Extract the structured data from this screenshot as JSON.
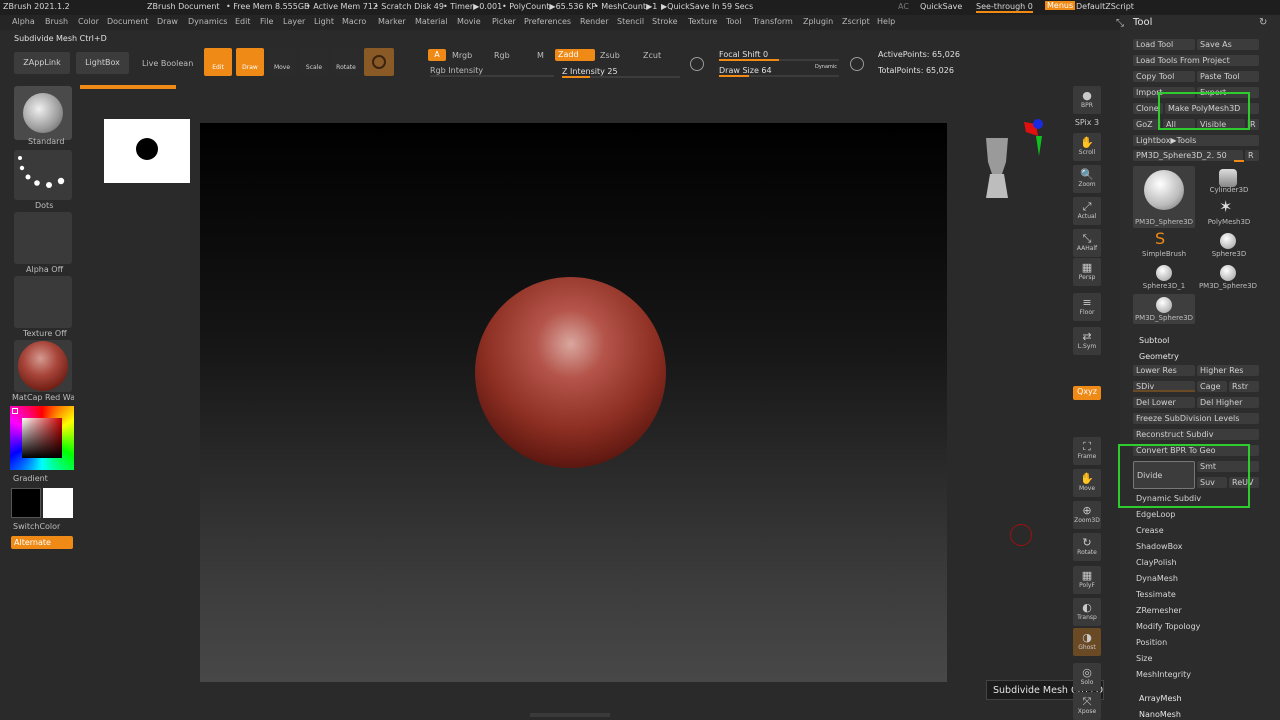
{
  "titlebar": {
    "app": "ZBrush 2021.1.2",
    "document": "ZBrush Document",
    "free_mem": "• Free Mem 8.555GB",
    "active_mem": "• Active Mem 712",
    "scratch": "• Scratch Disk 49",
    "timer": "• Timer▶0.001",
    "polycount": "• PolyCount▶65.536 KP",
    "meshcount": "• MeshCount▶1",
    "quicksave_timer": "▶QuickSave In 59 Secs",
    "ac": "AC",
    "quicksave": "QuickSave",
    "seethrough": "See-through  0",
    "menus": "Menus",
    "zscript": "DefaultZScript"
  },
  "menubar": [
    "Alpha",
    "Brush",
    "Color",
    "Document",
    "Draw",
    "Dynamics",
    "Edit",
    "File",
    "Layer",
    "Light",
    "Macro",
    "Marker",
    "Material",
    "Movie",
    "Picker",
    "Preferences",
    "Render",
    "Stencil",
    "Stroke",
    "Texture",
    "Tool",
    "Transform",
    "Zplugin",
    "Zscript",
    "Help"
  ],
  "subtitle": "Subdivide Mesh Ctrl+D",
  "topbar": {
    "zapplink": "ZAppLink",
    "lightbox": "LightBox",
    "liveboolean": "Live Boolean",
    "edit": "Edit",
    "draw": "Draw",
    "move": "Move",
    "scale": "Scale",
    "rotate": "Rotate",
    "a": "A",
    "mrgb": "Mrgb",
    "rgb": "Rgb",
    "m": "M",
    "zadd": "Zadd",
    "zsub": "Zsub",
    "zcut": "Zcut",
    "rgb_intensity": "Rgb Intensity",
    "z_intensity": "Z Intensity 25",
    "focal_shift": "Focal Shift 0",
    "draw_size": "Draw Size 64",
    "dynamic": "Dynamic",
    "active_points": "ActivePoints: 65,026",
    "total_points": "TotalPoints: 65,026"
  },
  "leftshelf": {
    "brush": "Standard",
    "stroke": "Dots",
    "alpha": "Alpha Off",
    "texture": "Texture Off",
    "material": "MatCap Red Wax",
    "gradient": "Gradient",
    "switchcolor": "SwitchColor",
    "alternate": "Alternate"
  },
  "rightshelf": [
    {
      "id": "bpr",
      "label": "BPR"
    },
    {
      "id": "spix",
      "label": "SPix 3"
    },
    {
      "id": "scroll",
      "label": "Scroll"
    },
    {
      "id": "zoom",
      "label": "Zoom"
    },
    {
      "id": "actual",
      "label": "Actual"
    },
    {
      "id": "aahalf",
      "label": "AAHalf"
    },
    {
      "id": "persp",
      "label": "Persp"
    },
    {
      "id": "floor",
      "label": "Floor"
    },
    {
      "id": "lsym",
      "label": "L.Sym"
    },
    {
      "id": "xyz",
      "label": "Qxyz"
    },
    {
      "id": "frame",
      "label": "Frame"
    },
    {
      "id": "move",
      "label": "Move"
    },
    {
      "id": "zoom3d",
      "label": "Zoom3D"
    },
    {
      "id": "rotate",
      "label": "Rotate"
    },
    {
      "id": "polyf",
      "label": "PolyF"
    },
    {
      "id": "transp",
      "label": "Transp"
    },
    {
      "id": "ghost",
      "label": "Ghost"
    },
    {
      "id": "solo",
      "label": "Solo"
    },
    {
      "id": "xpose",
      "label": "Xpose"
    }
  ],
  "toolpanel": {
    "title": "Tool",
    "load_tool": "Load Tool",
    "save_as": "Save As",
    "load_from_project": "Load Tools From Project",
    "copy_tool": "Copy Tool",
    "paste_tool": "Paste Tool",
    "import": "Import",
    "export": "Export",
    "clone": "Clone",
    "make_polymesh": "Make PolyMesh3D",
    "goz": "GoZ",
    "all": "All",
    "visible": "Visible",
    "r": "R",
    "lightbox_tools": "Lightbox▶Tools",
    "current_tool": "PM3D_Sphere3D_2. 50",
    "tools": [
      "PM3D_Sphere3D",
      "Cylinder3D",
      "PM3D_Sphere3D",
      "PolyMesh3D",
      "SimpleBrush",
      "Sphere3D",
      "Sphere3D_1",
      "PM3D_Sphere3D",
      "PM3D_Sphere3D"
    ],
    "subtool": "Subtool",
    "geometry": "Geometry",
    "lower_res": "Lower Res",
    "higher_res": "Higher Res",
    "sdiv": "SDiv",
    "cage": "Cage",
    "rstr": "Rstr",
    "del_lower": "Del Lower",
    "del_higher": "Del Higher",
    "freeze": "Freeze SubDivision Levels",
    "reconstruct": "Reconstruct Subdiv",
    "convert_bpr": "Convert BPR To Geo",
    "divide": "Divide",
    "smt": "Smt",
    "suv": "Suv",
    "reuv": "ReUV",
    "dynamic_subdiv": "Dynamic Subdiv",
    "sections": [
      "EdgeLoop",
      "Crease",
      "ShadowBox",
      "ClayPolish",
      "DynaMesh",
      "Tessimate",
      "ZRemesher",
      "Modify Topology",
      "Position",
      "Size",
      "MeshIntegrity"
    ],
    "arraymesh": "ArrayMesh",
    "nanomesh": "NanoMesh"
  },
  "tooltip": "Subdivide Mesh  Ctrl+D"
}
